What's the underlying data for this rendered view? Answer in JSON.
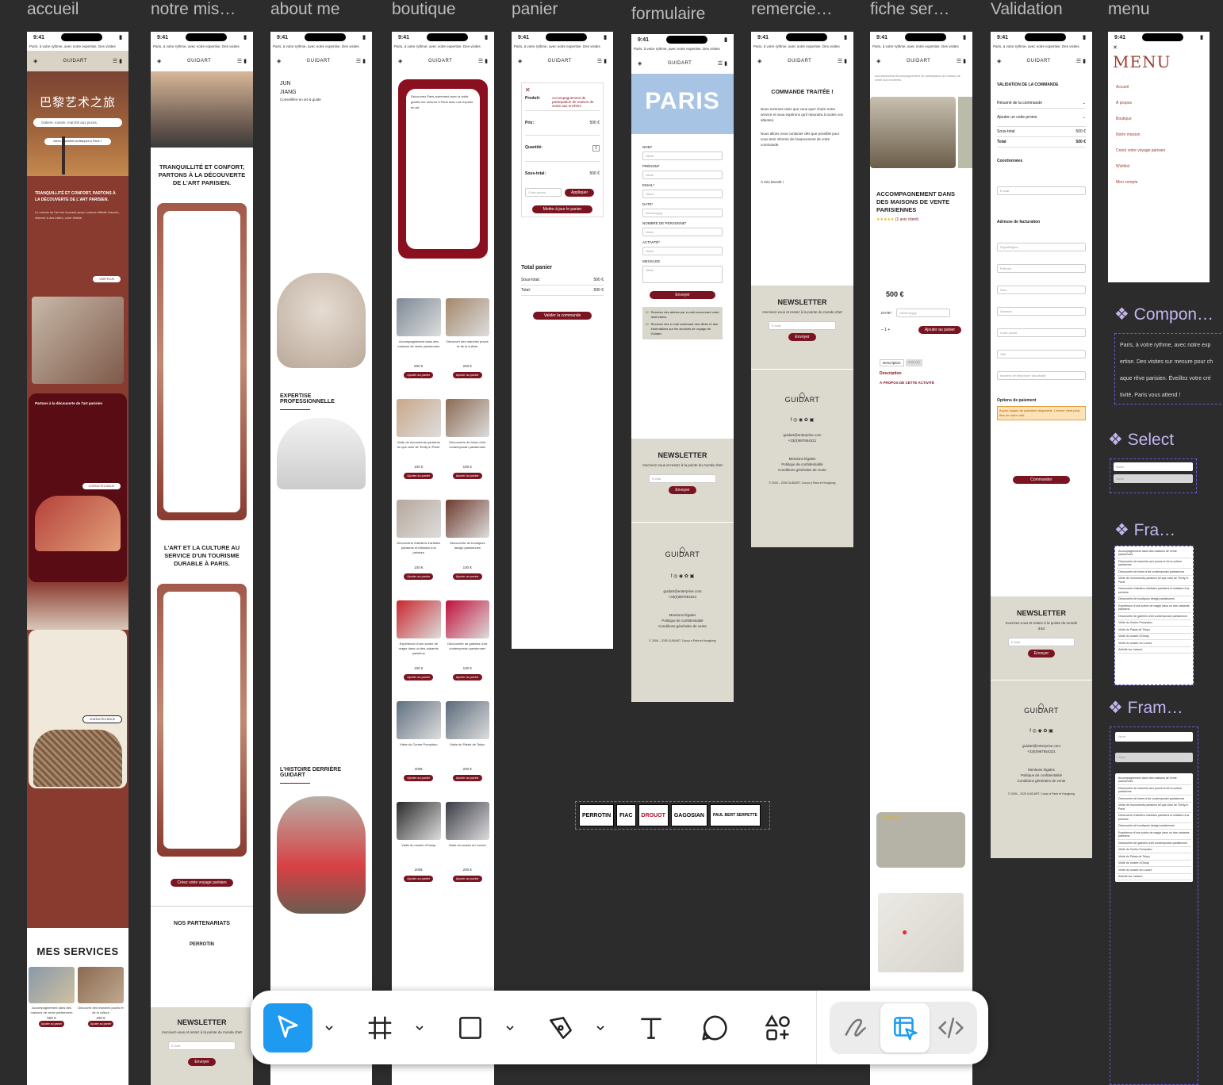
{
  "frames": [
    {
      "label": "accueil"
    },
    {
      "label": "notre mis…"
    },
    {
      "label": "about me"
    },
    {
      "label": "boutique"
    },
    {
      "label": "panier"
    },
    {
      "label": "formulaire"
    },
    {
      "label": "remercie…"
    },
    {
      "label": "fiche ser…"
    },
    {
      "label": "Validation"
    },
    {
      "label": "menu"
    }
  ],
  "phone": {
    "time": "9:41",
    "marquee": "Paris, à votre rythme, avec notre expertise. Des visites",
    "brand": "GUIDART",
    "brand_sub": "PARIS"
  },
  "accueil": {
    "hero_title": "巴黎艺术之旅",
    "search_placeholder": "Galerie, musée, marché aux puces,",
    "ideas_button": "Idées d'activités artistiques à Paris ?",
    "band_title": "TRANQUILLITÉ ET CONFORT, PARTONS À LA DÉCOUVERTE DE L'ART PARISIEN.",
    "band_text": "Le monde de l'art est souvent perçu comme difficile d'accès, réservé à des initiés, voire élitiste.",
    "see_more": "VOIR PLUS",
    "card_title": "Partons à la découverte de l'art parisien",
    "contact_button": "CONTACTEZ-NOUS",
    "services_title": "MES SERVICES",
    "service_1": "Accompagnement dans des maisons de vente parisiennes",
    "service_2": "Découvrir des marchés puces et de la culture",
    "price_1": "500 €",
    "price_2": "200 €",
    "add_to_cart": "Ajouter au panier"
  },
  "mission": {
    "title": "TRANQUILLITÉ ET CONFORT, PARTONS À LA DÉCOUVERTE DE L'ART PARISIEN.",
    "title2": "L'ART ET LA CULTURE AU SERVICE D'UN TOURISME DURABLE À PARIS.",
    "cta": "Créez votre voyage parisien",
    "partners_title": "NOS PARTENARIATS",
    "partner": "PERROTIN",
    "newsletter_title": "NEWSLETTER",
    "newsletter_text": "Inscrivez-vous et restez à la pointe du monde d'art",
    "email_placeholder": "E-mail",
    "send": "Envoyer"
  },
  "about": {
    "first_name": "JUN",
    "last_name": "JIANG",
    "role": "Conseillère en art & guide",
    "section1": "EXPERTISE PROFESSIONNELLE",
    "section2": "L'HISTOIRE DERRIÈRE GUIDART"
  },
  "boutique": {
    "intro": "Découvrez Paris autrement avec la visite guidée sur mesure à Paris avec une experte en art.",
    "products": [
      {
        "name": "Accompagnement dans des maisons de vente parisiennes",
        "price": "500 €"
      },
      {
        "name": "Découvrir des marchés puces et de la culture",
        "price": "200 €"
      },
      {
        "name": "Visite de monuments parisiens tel que celui de 'Emily in Paris'",
        "price": "100 €"
      },
      {
        "name": "Découverte de foires d'art contemporain parisiennes",
        "price": "100 €"
      },
      {
        "name": "Découverte d'ateliers d'artistes parisiens et initiation à la peinture",
        "price": "100 €"
      },
      {
        "name": "Découverte de boutiques design parisiennes",
        "price": "100 €"
      },
      {
        "name": "Expérience d'une soirée de magie dans un des cabarets parisiens",
        "price": "100 €"
      },
      {
        "name": "Découverte de galeries d'art contemporain parisiennes",
        "price": "100 €"
      },
      {
        "name": "Visite du Centre Pompidou",
        "price": "200€"
      },
      {
        "name": "Visite du Palais de Tokyo",
        "price": "200 €"
      },
      {
        "name": "Visite du musée d'Orsay",
        "price": "200€"
      },
      {
        "name": "Visite du musée du Louvre",
        "price": "200 €"
      }
    ],
    "add": "Ajouter au panier"
  },
  "panier": {
    "product_label": "Produit:",
    "product_value": "Accompagnement de participation de maison de vente aux enchère",
    "price_label": "Prix:",
    "price_value": "500 €",
    "qty_label": "Quantité:",
    "qty_value": "1",
    "subtotal_label": "Sous-total:",
    "subtotal_value": "500 €",
    "promo_placeholder": "Code promo",
    "apply": "Appliquer",
    "update": "Mettre à jour le panier",
    "total_title": "Total panier",
    "sous_total": "Sous-total:",
    "total": "Total:",
    "total_value": "500 €",
    "validate": "Valider la commande"
  },
  "formulaire": {
    "hero": "PARIS",
    "fields": [
      "NOM*",
      "PRÉNOM*",
      "EMAIL*",
      "DATE*",
      "NOMBRE DE PERSONNE*",
      "ACTIVITÉ*",
      "MESSAGE"
    ],
    "value_placeholder": "Value",
    "date_placeholder": "dd/mm/yyyy",
    "send": "Envoyer",
    "check1": "Recevez des alertes par e-mail concernant votre réservation.",
    "check2": "Recevez des e-mail contenant des offres et des informations sur les services de voyage de Guidart.",
    "email": "guidart@enterprise.com",
    "phone": "+33(0)987654321",
    "legal1": "Mentions légales",
    "legal2": "Politique de confidentialité",
    "legal3": "Conditions générales de vente",
    "copyright": "© 2005 – 2025 GUIDART. Conçu à Paris et Hongkong"
  },
  "remerciement": {
    "title": "COMMANDE TRAITÉE !",
    "text1": "Nous sommes ravis que vous ayez choisi notre service et nous espérons qu'il répondra à toutes vos attentes.",
    "text2": "Nous allons vous contacter dès que possible pour vous tenir informé de l'avancement de votre commande.",
    "bye": "À très bientôt !"
  },
  "fiche": {
    "breadcrumb": "Accueil/auction/Accompagnement de participation de maison de vente aux enchères",
    "title": "ACCOMPAGNEMENT DANS DES MAISONS DE VENTE PARISIENNES",
    "review": "(1 avis client)",
    "price": "500 €",
    "date_label": "DATE*",
    "add": "Ajouter au panier",
    "tab1": "Description",
    "tab2": "Avis (1)",
    "desc_title": "Description",
    "about_title": "À PROPOS DE CETTE ACTIVITÉ"
  },
  "validation": {
    "title": "VALIDATION DE LA COMMANDE",
    "summary": "Résumé de la commande",
    "promo": "Ajouter un code promo",
    "subtotal": "Sous-total",
    "subtotal_value": "500 €",
    "total": "Total",
    "total_value": "500 €",
    "coords": "Coordonnées",
    "email": "E-mail",
    "billing": "Adresse de facturation",
    "country": "Pays/Région",
    "firstname": "Prénom",
    "lastname": "Nom",
    "address": "Adresse",
    "postal": "Code postal",
    "city": "Ville",
    "phone": "Numéro de téléphone (facultatif)",
    "payment": "Options de paiement",
    "payment_warning": "Aucun moyen de paiement disponible. L'erreur vient peut-être de notre côté.",
    "order": "Commander"
  },
  "menu": {
    "title": "MENU",
    "items": [
      "Accueil",
      "À propos",
      "Boutique",
      "Notre mission",
      "Créez votre voyage parisien",
      "Wishlist",
      "Mon compte"
    ]
  },
  "side_panels": {
    "component": "Compon…",
    "select": "Select",
    "frame1": "Fra…",
    "frame2": "Fram…",
    "component_text": [
      "Paris, à votre rythme, avec notre exp",
      "ertise. Des visites sur mesure pour ch",
      "aque rêve parisien. Éveillez votre cré",
      "tivité, Paris vous attend !"
    ],
    "select_values": [
      "Value",
      "Value"
    ],
    "list": [
      "Accompagnement dans des maisons de vente parisiennes",
      "Découverte de marchés aux puces et de la culture parisienne",
      "Découverte de foires d'art contemporain parisiennes",
      "Visite de monuments parisiens tel que celui de 'Emily in Paris'",
      "Découverte d'ateliers d'artistes parisiens et initiation à la peinture",
      "Découverte de boutiques design parisiennes",
      "Expérience d'une soirée de magie dans un des cabarets parisiens",
      "Découverte de galeries d'art contemporain parisiennes",
      "Visite du Centre Pompidou",
      "Visite du Palais de Tokyo",
      "Visite du musée d'Orsay",
      "Visite du musée du Louvre",
      "Activité sur mesure"
    ]
  },
  "partners_strip": [
    "PERROTIN",
    "FIAC",
    "DROUOT",
    "GAGOSIAN",
    "PAUL BERT SERPETTE"
  ],
  "toolbar": {
    "tools": [
      "move-tool",
      "frame-tool",
      "shape-tool",
      "pen-tool",
      "text-tool",
      "comment-tool",
      "actions-tool"
    ],
    "modes": [
      "draw-mode",
      "design-mode",
      "dev-mode"
    ],
    "accent": "#1e9bf0"
  }
}
